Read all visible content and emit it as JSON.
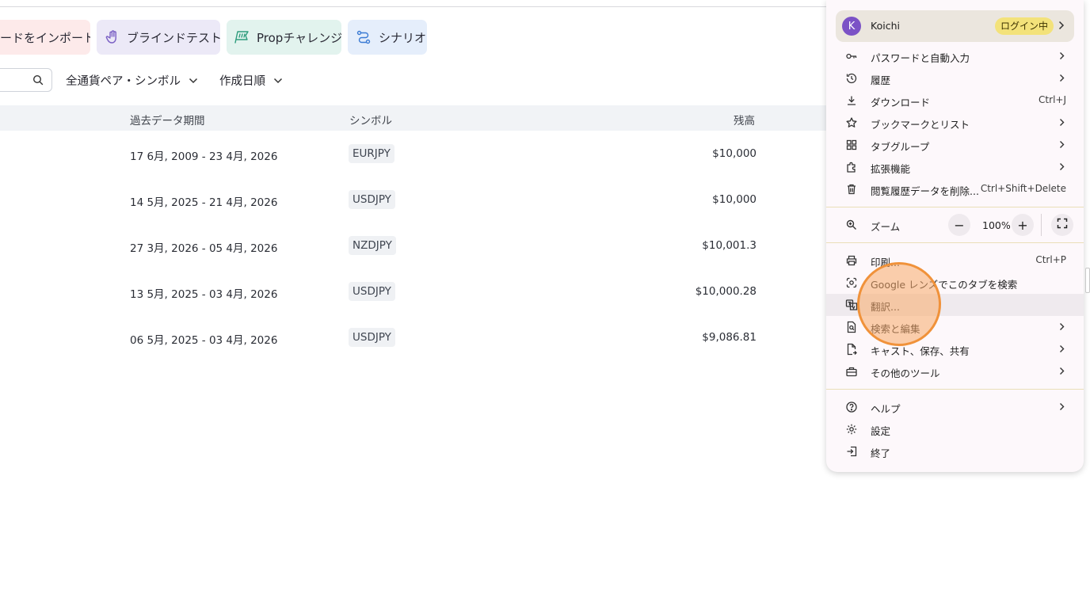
{
  "toolbar": {
    "import_label": "ードをインポート",
    "blind_label": "ブラインドテスト",
    "prop_label": "Propチャレンジ",
    "scenario_label": "シナリオ"
  },
  "filters": {
    "symbol_filter": "全通貨ペア・シンボル",
    "sort_filter": "作成日順"
  },
  "table": {
    "headers": {
      "period": "過去データ期間",
      "symbol": "シンボル",
      "balance": "残高"
    },
    "rows": [
      {
        "period": "17 6月, 2009 - 23 4月, 2026",
        "symbol": "EURJPY",
        "balance": "$10,000"
      },
      {
        "period": "14 5月, 2025 - 21 4月, 2026",
        "symbol": "USDJPY",
        "balance": "$10,000"
      },
      {
        "period": "27 3月, 2026 - 05 4月, 2026",
        "symbol": "NZDJPY",
        "balance": "$10,001.3"
      },
      {
        "period": "13 5月, 2025 - 03 4月, 2026",
        "symbol": "USDJPY",
        "balance": "$10,000.28"
      },
      {
        "period": "06 5月, 2025 - 03 4月, 2026",
        "symbol": "USDJPY",
        "balance": "$9,086.81"
      }
    ]
  },
  "menu": {
    "profile": {
      "avatar_letter": "K",
      "name": "Koichi",
      "status": "ログイン中"
    },
    "items": {
      "passwords": "パスワードと自動入力",
      "history": "履歴",
      "downloads": "ダウンロード",
      "downloads_shortcut": "Ctrl+J",
      "bookmarks": "ブックマークとリスト",
      "tab_groups": "タブグループ",
      "extensions": "拡張機能",
      "clear_data": "閲覧履歴データを削除...",
      "clear_data_shortcut": "Ctrl+Shift+Delete",
      "zoom": "ズーム",
      "zoom_value": "100%",
      "zoom_minus": "−",
      "zoom_plus": "+",
      "print": "印刷...",
      "print_shortcut": "Ctrl+P",
      "lens": "Google レンズでこのタブを検索",
      "translate": "翻訳...",
      "find_edit": "検索と編集",
      "cast_save": "キャスト、保存、共有",
      "more_tools": "その他のツール",
      "help": "ヘルプ",
      "settings": "設定",
      "exit": "終了"
    }
  },
  "colors": {
    "accent": "#7b52c6",
    "login_badge": "#f3e27a",
    "cursor_ring": "#f0923a"
  }
}
